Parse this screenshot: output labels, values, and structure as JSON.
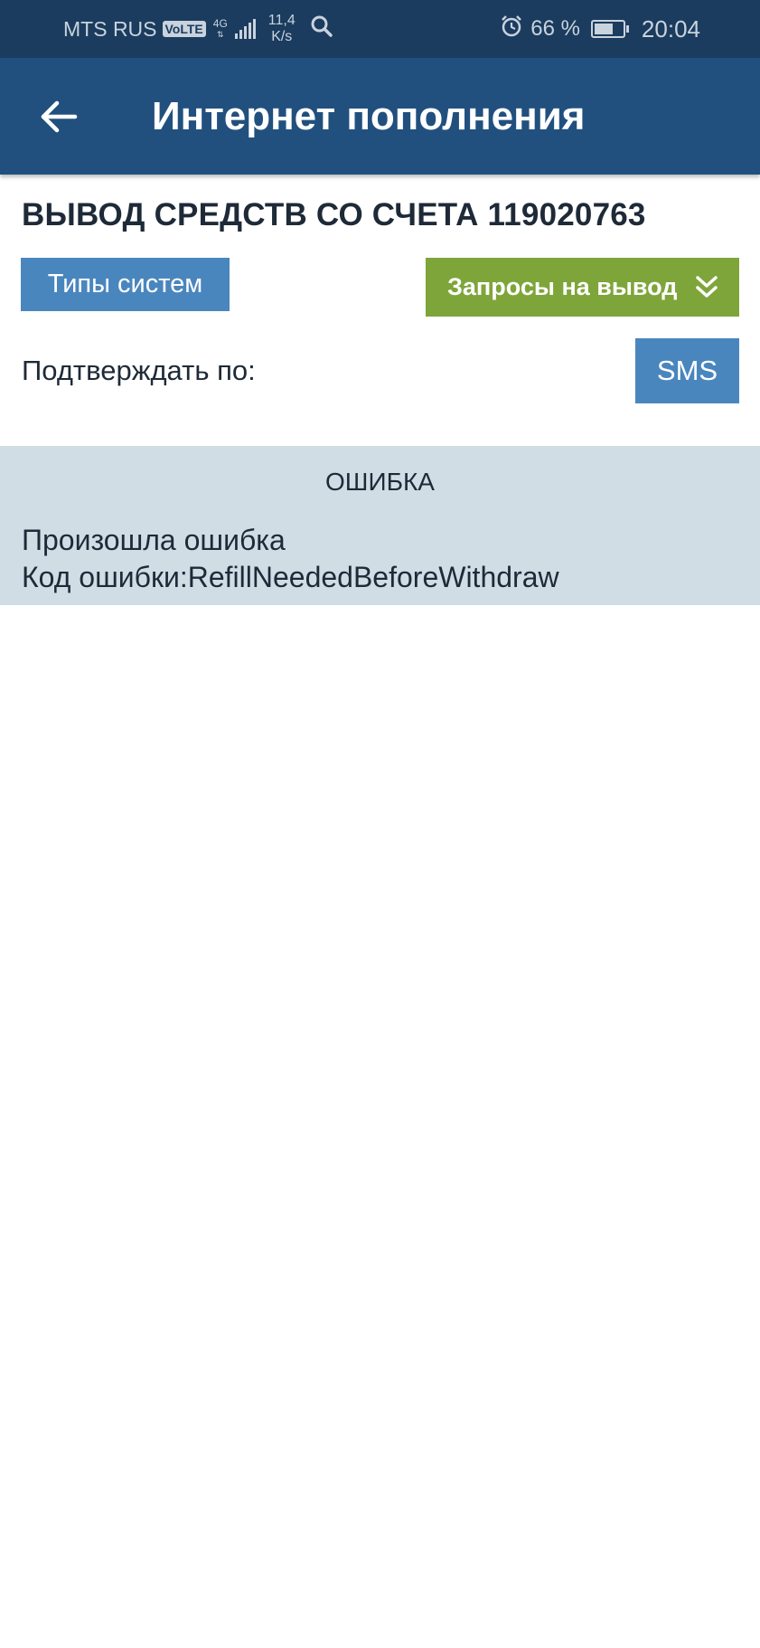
{
  "status_bar": {
    "carrier": "MTS RUS",
    "volte": "VoLTE",
    "network": "4G",
    "speed_value": "11,4",
    "speed_unit": "K/s",
    "battery_percent": "66 %",
    "battery_level": 0.66,
    "time": "20:04"
  },
  "app_bar": {
    "title": "Интернет пополнения"
  },
  "page": {
    "section_title": "ВЫВОД СРЕДСТВ СО СЧЕТА 119020763",
    "types_button": "Типы систем",
    "requests_button": "Запросы на вывод",
    "confirm_label": "Подтверждать по:",
    "sms_button": "SMS"
  },
  "error": {
    "heading": "ОШИБКА",
    "message": "Произошла ошибка",
    "code": "Код ошибки:RefillNeededBeforeWithdraw"
  },
  "colors": {
    "status_bar": "#1b3c5e",
    "app_bar": "#21507f",
    "primary_button": "#4a86be",
    "accent_button": "#7ea53a",
    "error_panel": "#d1dde4"
  }
}
